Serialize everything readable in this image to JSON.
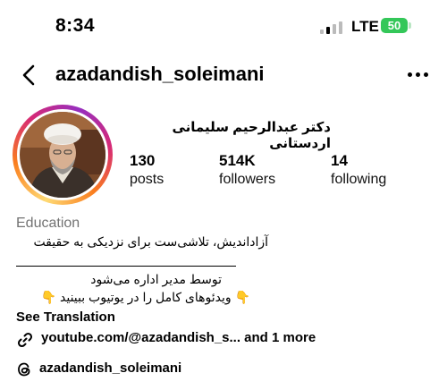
{
  "status_bar": {
    "time": "8:34",
    "network": "LTE",
    "battery": "50"
  },
  "header": {
    "username": "azadandish_soleimani",
    "back_icon": "chevron-left-icon",
    "more_icon": "more-horizontal-icon"
  },
  "profile": {
    "full_name": "دکتر عبدالرحیم سلیمانی اردستانی",
    "stats": [
      {
        "value": "130",
        "label": "posts"
      },
      {
        "value": "514K",
        "label": "followers"
      },
      {
        "value": "14",
        "label": "following"
      }
    ],
    "category": "Education",
    "bio_line1": "آزاداندیش، تلاشی‌ست برای نزدیکی به حقیقت",
    "bio_line2": "توسط مدیر اداره می‌شود",
    "bio_line3": "👇 ویدئوهای کامل را در یوتیوب ببینید 👇",
    "see_translation": "See Translation",
    "link": "youtube.com/@azadandish_s...  and 1 more",
    "threads": "azadandish_soleimani"
  },
  "colors": {
    "battery": "#34c759",
    "muted": "#737373"
  }
}
